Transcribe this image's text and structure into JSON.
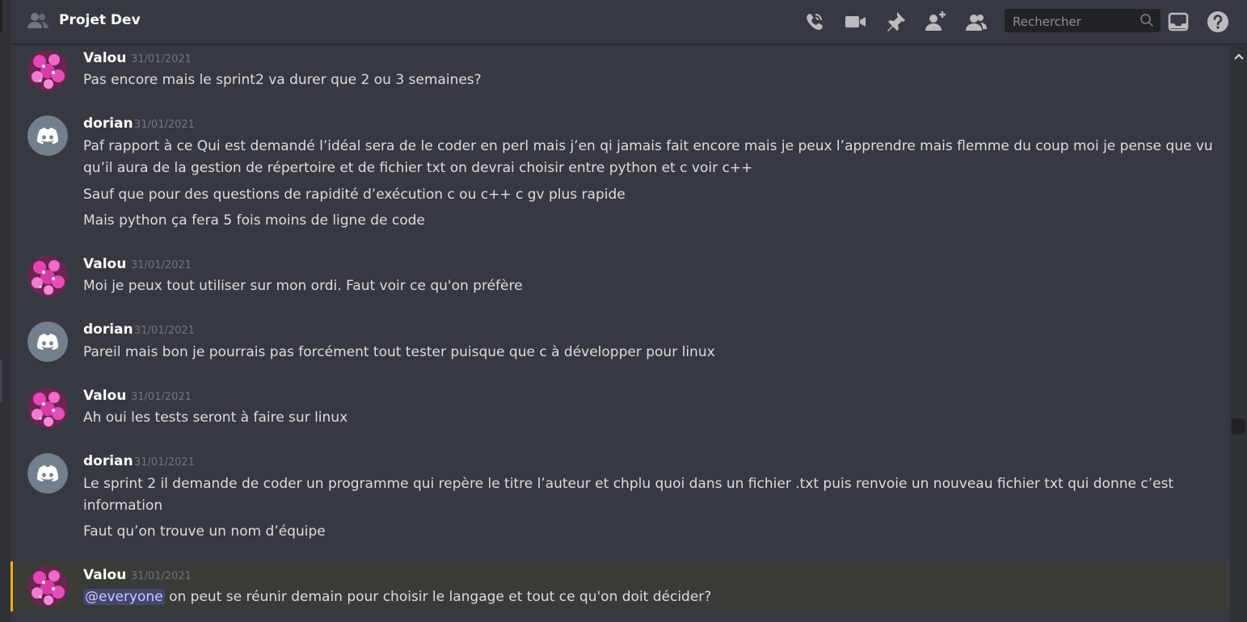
{
  "channel": {
    "title": "Projet Dev"
  },
  "search": {
    "placeholder": "Rechercher"
  },
  "colors": {
    "background": "#36393f",
    "mention_bg": "#5865f2",
    "highlight_bar": "#faa81a",
    "discord_blurple": "#7289da"
  },
  "header_icons": [
    "call-icon",
    "video-icon",
    "pin-icon",
    "add-member-icon",
    "members-icon",
    "inbox-icon",
    "help-icon"
  ],
  "messages": [
    {
      "author": "Valou",
      "timestamp": "31/01/2021",
      "avatar": "flower-avatar",
      "lines": [
        "Pas encore mais le sprint2 va durer que 2 ou 3 semaines?"
      ]
    },
    {
      "author": "dorian",
      "timestamp": "31/01/2021",
      "avatar": "discord-default-avatar",
      "lines": [
        "Paf rapport à ce Qui est demandé l’idéal sera de le coder en perl mais j’en qi jamais fait encore mais je peux l’apprendre mais flemme du coup moi je pense que vu",
        "qu’il aura de la gestion de répertoire et de fichier txt on devrai choisir entre python et c voir c++",
        "Sauf que pour des questions de rapidité d’exécution c ou c++ c gv plus rapide",
        "Mais python ça fera 5 fois moins de ligne de code"
      ]
    },
    {
      "author": "Valou",
      "timestamp": "31/01/2021",
      "avatar": "flower-avatar",
      "lines": [
        "Moi je peux tout utiliser sur mon ordi. Faut voir ce qu'on préfère"
      ]
    },
    {
      "author": "dorian",
      "timestamp": "31/01/2021",
      "avatar": "discord-default-avatar",
      "lines": [
        "Pareil mais bon je pourrais pas forcément tout tester puisque que c à développer pour linux"
      ]
    },
    {
      "author": "Valou",
      "timestamp": "31/01/2021",
      "avatar": "flower-avatar",
      "lines": [
        "Ah oui les tests seront à faire sur linux"
      ]
    },
    {
      "author": "dorian",
      "timestamp": "31/01/2021",
      "avatar": "discord-default-avatar",
      "lines": [
        "Le sprint 2 il demande de coder un programme qui repère le titre l’auteur et chplu quoi dans un fichier .txt  puis renvoie un nouveau fichier txt qui donne c’est",
        "information",
        "Faut qu’on trouve un nom d’équipe"
      ]
    },
    {
      "author": "Valou",
      "timestamp": "31/01/2021",
      "avatar": "flower-avatar",
      "mention": "@everyone",
      "lines": [
        "on peut se réunir demain pour choisir le langage et tout ce qu'on doit décider?"
      ]
    }
  ]
}
